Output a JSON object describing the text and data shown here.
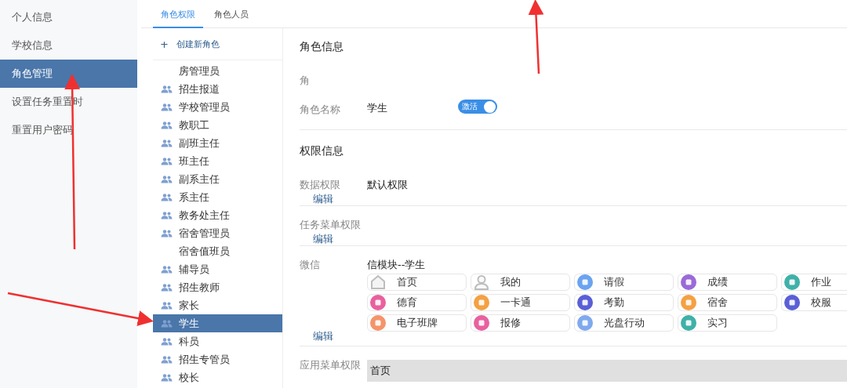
{
  "sidebar": {
    "items": [
      {
        "label": "个人信息",
        "selected": false
      },
      {
        "label": "学校信息",
        "selected": false
      },
      {
        "label": "角色管理",
        "selected": true
      },
      {
        "label": "设置任务重置时",
        "selected": false
      },
      {
        "label": "重置用户密码",
        "selected": false
      }
    ]
  },
  "tabs": [
    {
      "label": "角色权限",
      "selected": true
    },
    {
      "label": "角色人员",
      "selected": false
    }
  ],
  "role_list": {
    "create_icon": "+",
    "create_label": "创建新角色",
    "roles": [
      {
        "label": "房管理员",
        "selected": false,
        "icon": false
      },
      {
        "label": "招生报道",
        "selected": false,
        "icon": true
      },
      {
        "label": "学校管理员",
        "selected": false,
        "icon": true
      },
      {
        "label": "教职工",
        "selected": false,
        "icon": true
      },
      {
        "label": "副班主任",
        "selected": false,
        "icon": true
      },
      {
        "label": "班主任",
        "selected": false,
        "icon": true
      },
      {
        "label": "副系主任",
        "selected": false,
        "icon": true
      },
      {
        "label": "系主任",
        "selected": false,
        "icon": true
      },
      {
        "label": "教务处主任",
        "selected": false,
        "icon": true
      },
      {
        "label": "宿舍管理员",
        "selected": false,
        "icon": true
      },
      {
        "label": "宿舍值班员",
        "selected": false,
        "icon": false
      },
      {
        "label": "辅导员",
        "selected": false,
        "icon": true
      },
      {
        "label": "招生教师",
        "selected": false,
        "icon": true
      },
      {
        "label": "家长",
        "selected": false,
        "icon": true
      },
      {
        "label": "学生",
        "selected": true,
        "icon": true
      },
      {
        "label": "科员",
        "selected": false,
        "icon": true
      },
      {
        "label": "招生专管员",
        "selected": false,
        "icon": true
      },
      {
        "label": "校长",
        "selected": false,
        "icon": true
      }
    ]
  },
  "role_info": {
    "title": "角色信息",
    "partial_label": "角",
    "name_label": "角色名称",
    "name_value": "学生",
    "status": {
      "label": "激活",
      "on": true
    }
  },
  "permissions": {
    "title": "权限信息",
    "data": {
      "label": "数据权限",
      "value": "默认权限",
      "edit": "编辑"
    },
    "task_menu": {
      "label": "任务菜单权限",
      "edit": "编辑"
    },
    "wechat": {
      "label": "微信",
      "module": "信模块--学生",
      "edit": "编辑",
      "items": [
        {
          "label": "首页",
          "kind": "house",
          "color": "#bdbdbd"
        },
        {
          "label": "我的",
          "kind": "person",
          "color": "#bdbdbd"
        },
        {
          "label": "请假",
          "kind": "badge",
          "color": "#6aa3f0"
        },
        {
          "label": "成绩",
          "kind": "badge",
          "color": "#9a6ad8"
        },
        {
          "label": "作业",
          "kind": "badge",
          "color": "#3fb1a8"
        },
        {
          "label": "德育",
          "kind": "badge",
          "color": "#e9609f"
        },
        {
          "label": "一卡通",
          "kind": "badge",
          "color": "#f5a043"
        },
        {
          "label": "考勤",
          "kind": "badge",
          "color": "#5a5fd6"
        },
        {
          "label": "宿舍",
          "kind": "badge",
          "color": "#f5a043"
        },
        {
          "label": "校服",
          "kind": "badge",
          "color": "#5a5fd6"
        },
        {
          "label": "电子班牌",
          "kind": "badge",
          "color": "#f4946a"
        },
        {
          "label": "报修",
          "kind": "badge",
          "color": "#e9609f"
        },
        {
          "label": "光盘行动",
          "kind": "badge",
          "color": "#7fa9ee"
        },
        {
          "label": "实习",
          "kind": "badge",
          "color": "#3fb1a8"
        }
      ]
    },
    "app_menu": {
      "label": "应用菜单权限",
      "value": "首页"
    }
  }
}
